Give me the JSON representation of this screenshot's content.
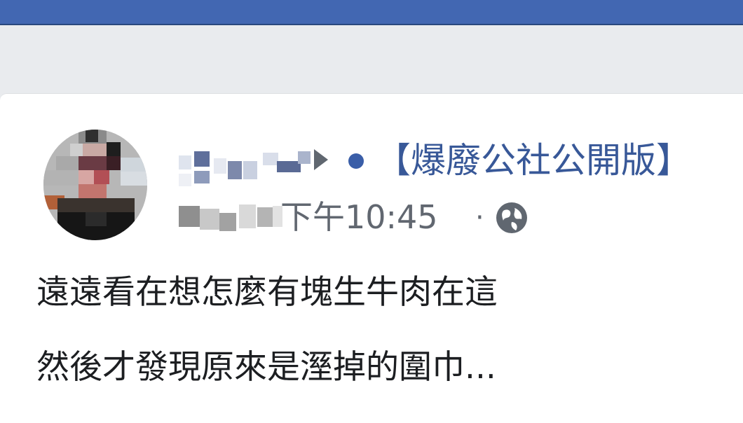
{
  "header": {
    "bar_color": "#4267b2"
  },
  "post": {
    "group_name": "【爆廢公社公開版】",
    "time_text": "下午10:45",
    "separator": "·",
    "privacy_icon": "globe-icon",
    "author_name_visible": false,
    "body_lines": [
      "遠遠看在想怎麼有塊生牛肉在這",
      "然後才發現原來是溼掉的圍巾..."
    ]
  },
  "colors": {
    "link": "#385898",
    "meta": "#616770",
    "text": "#1c1e21",
    "background": "#e9ebee"
  }
}
